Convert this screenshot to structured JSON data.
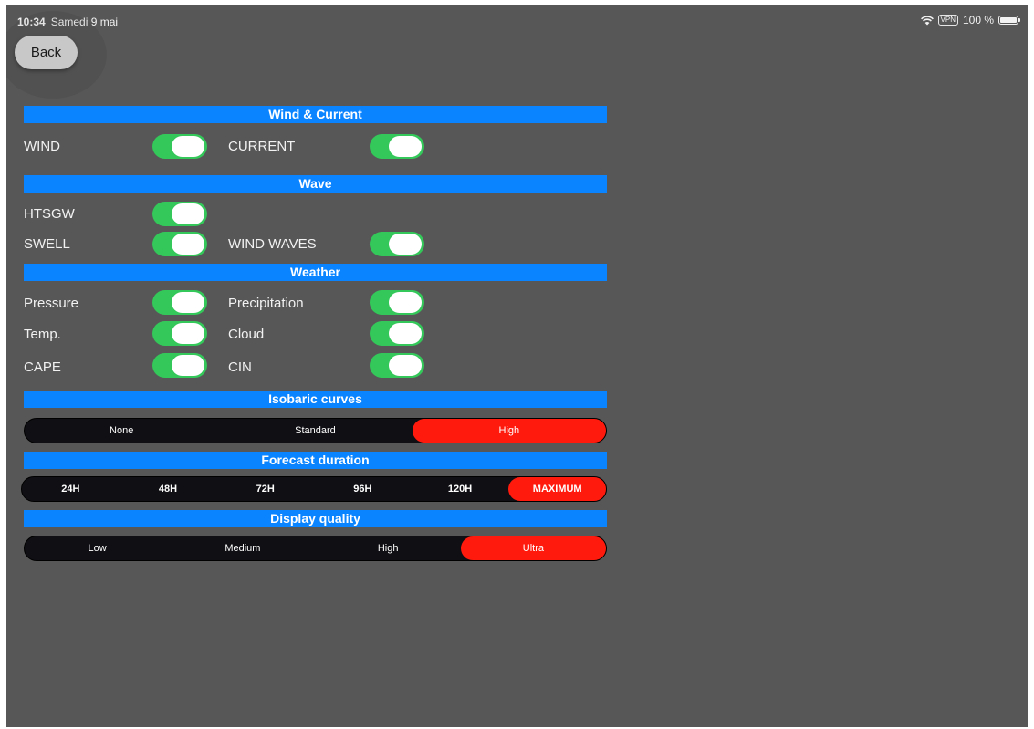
{
  "status_bar": {
    "time": "10:34",
    "date": "Samedi 9 mai",
    "vpn": "VPN",
    "battery": "100 %"
  },
  "back_label": "Back",
  "sections": {
    "wind_current": "Wind & Current",
    "wave": "Wave",
    "weather": "Weather",
    "isobaric": "Isobaric curves",
    "forecast": "Forecast duration",
    "quality": "Display quality"
  },
  "toggles": {
    "wind": {
      "label": "WIND",
      "on": true
    },
    "current": {
      "label": "CURRENT",
      "on": true
    },
    "htsgw": {
      "label": "HTSGW",
      "on": true
    },
    "swell": {
      "label": "SWELL",
      "on": true
    },
    "wind_waves": {
      "label": "WIND WAVES",
      "on": true
    },
    "pressure": {
      "label": "Pressure",
      "on": true
    },
    "precipitation": {
      "label": "Precipitation",
      "on": true
    },
    "temp": {
      "label": "Temp.",
      "on": true
    },
    "cloud": {
      "label": "Cloud",
      "on": true
    },
    "cape": {
      "label": "CAPE",
      "on": true
    },
    "cin": {
      "label": "CIN",
      "on": true
    }
  },
  "isobaric_options": [
    "None",
    "Standard",
    "High"
  ],
  "isobaric_selected": "High",
  "forecast_options": [
    "24H",
    "48H",
    "72H",
    "96H",
    "120H",
    "MAXIMUM"
  ],
  "forecast_selected": "MAXIMUM",
  "quality_options": [
    "Low",
    "Medium",
    "High",
    "Ultra"
  ],
  "quality_selected": "Ultra",
  "colors": {
    "background": "#575757",
    "header_blue": "#0b84ff",
    "toggle_green": "#34c759",
    "selected_red": "#ff1a0d"
  }
}
